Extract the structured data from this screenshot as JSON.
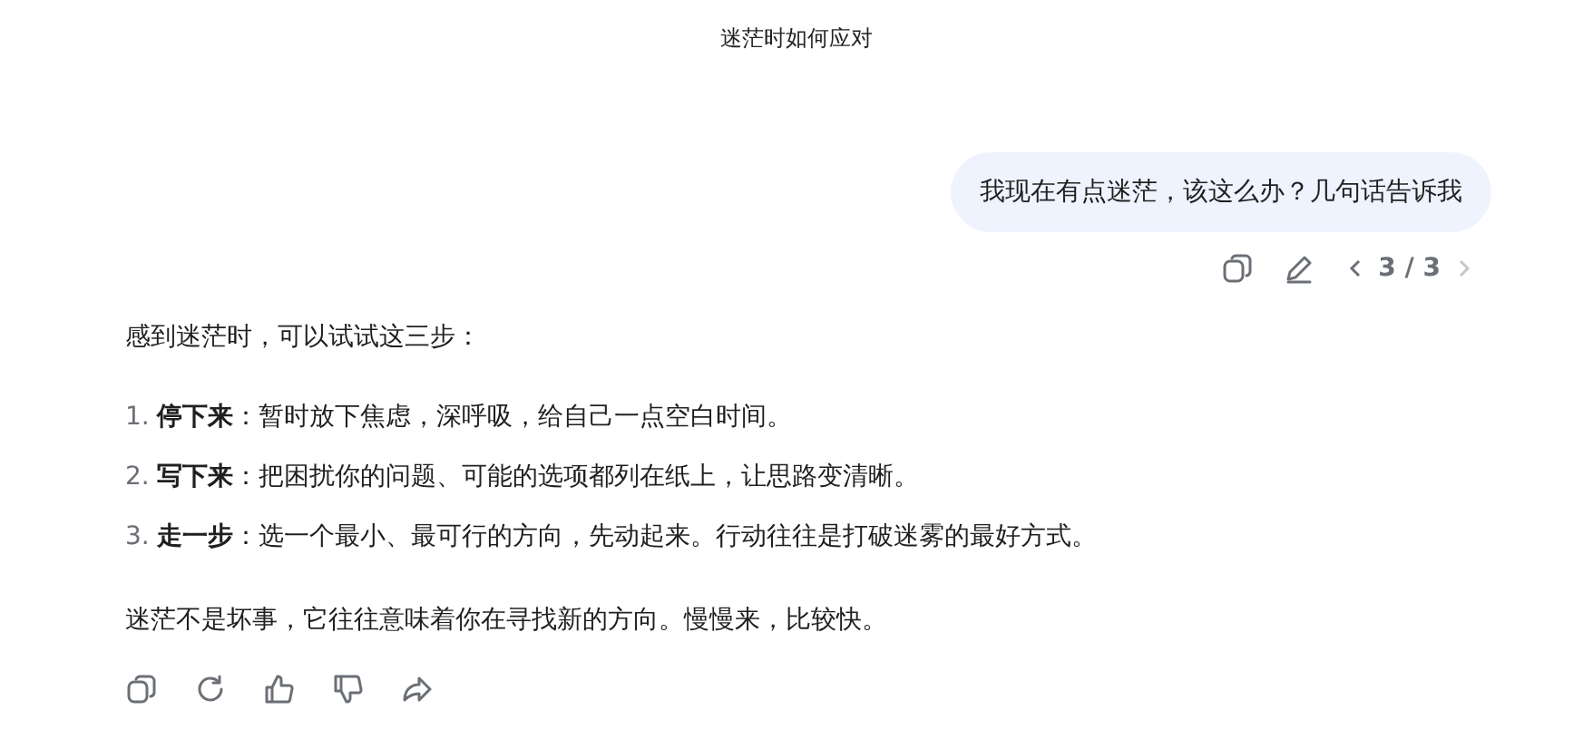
{
  "title": "迷茫时如何应对",
  "user_message": {
    "text": "我现在有点迷茫，该这么办？几句话告诉我",
    "pager": "3 / 3"
  },
  "reply": {
    "intro": "感到迷茫时，可以试试这三步：",
    "steps": [
      {
        "number": "1.",
        "text": "**停下来**：暂时放下焦虑，深呼吸，给自己一点空白时间。"
      },
      {
        "number": "2.",
        "text": "**写下来**：把困扰你的问题、可能的选项都列在纸上，让思路变清晰。"
      },
      {
        "number": "3.",
        "text": "**走一步**：选一个最小、最可行的方向，先动起来。行动往往是打破迷雾的最好方式。"
      }
    ],
    "closing": "迷茫不是坏事，它往往意味着你在寻找新的方向。慢慢来，比较快。"
  }
}
